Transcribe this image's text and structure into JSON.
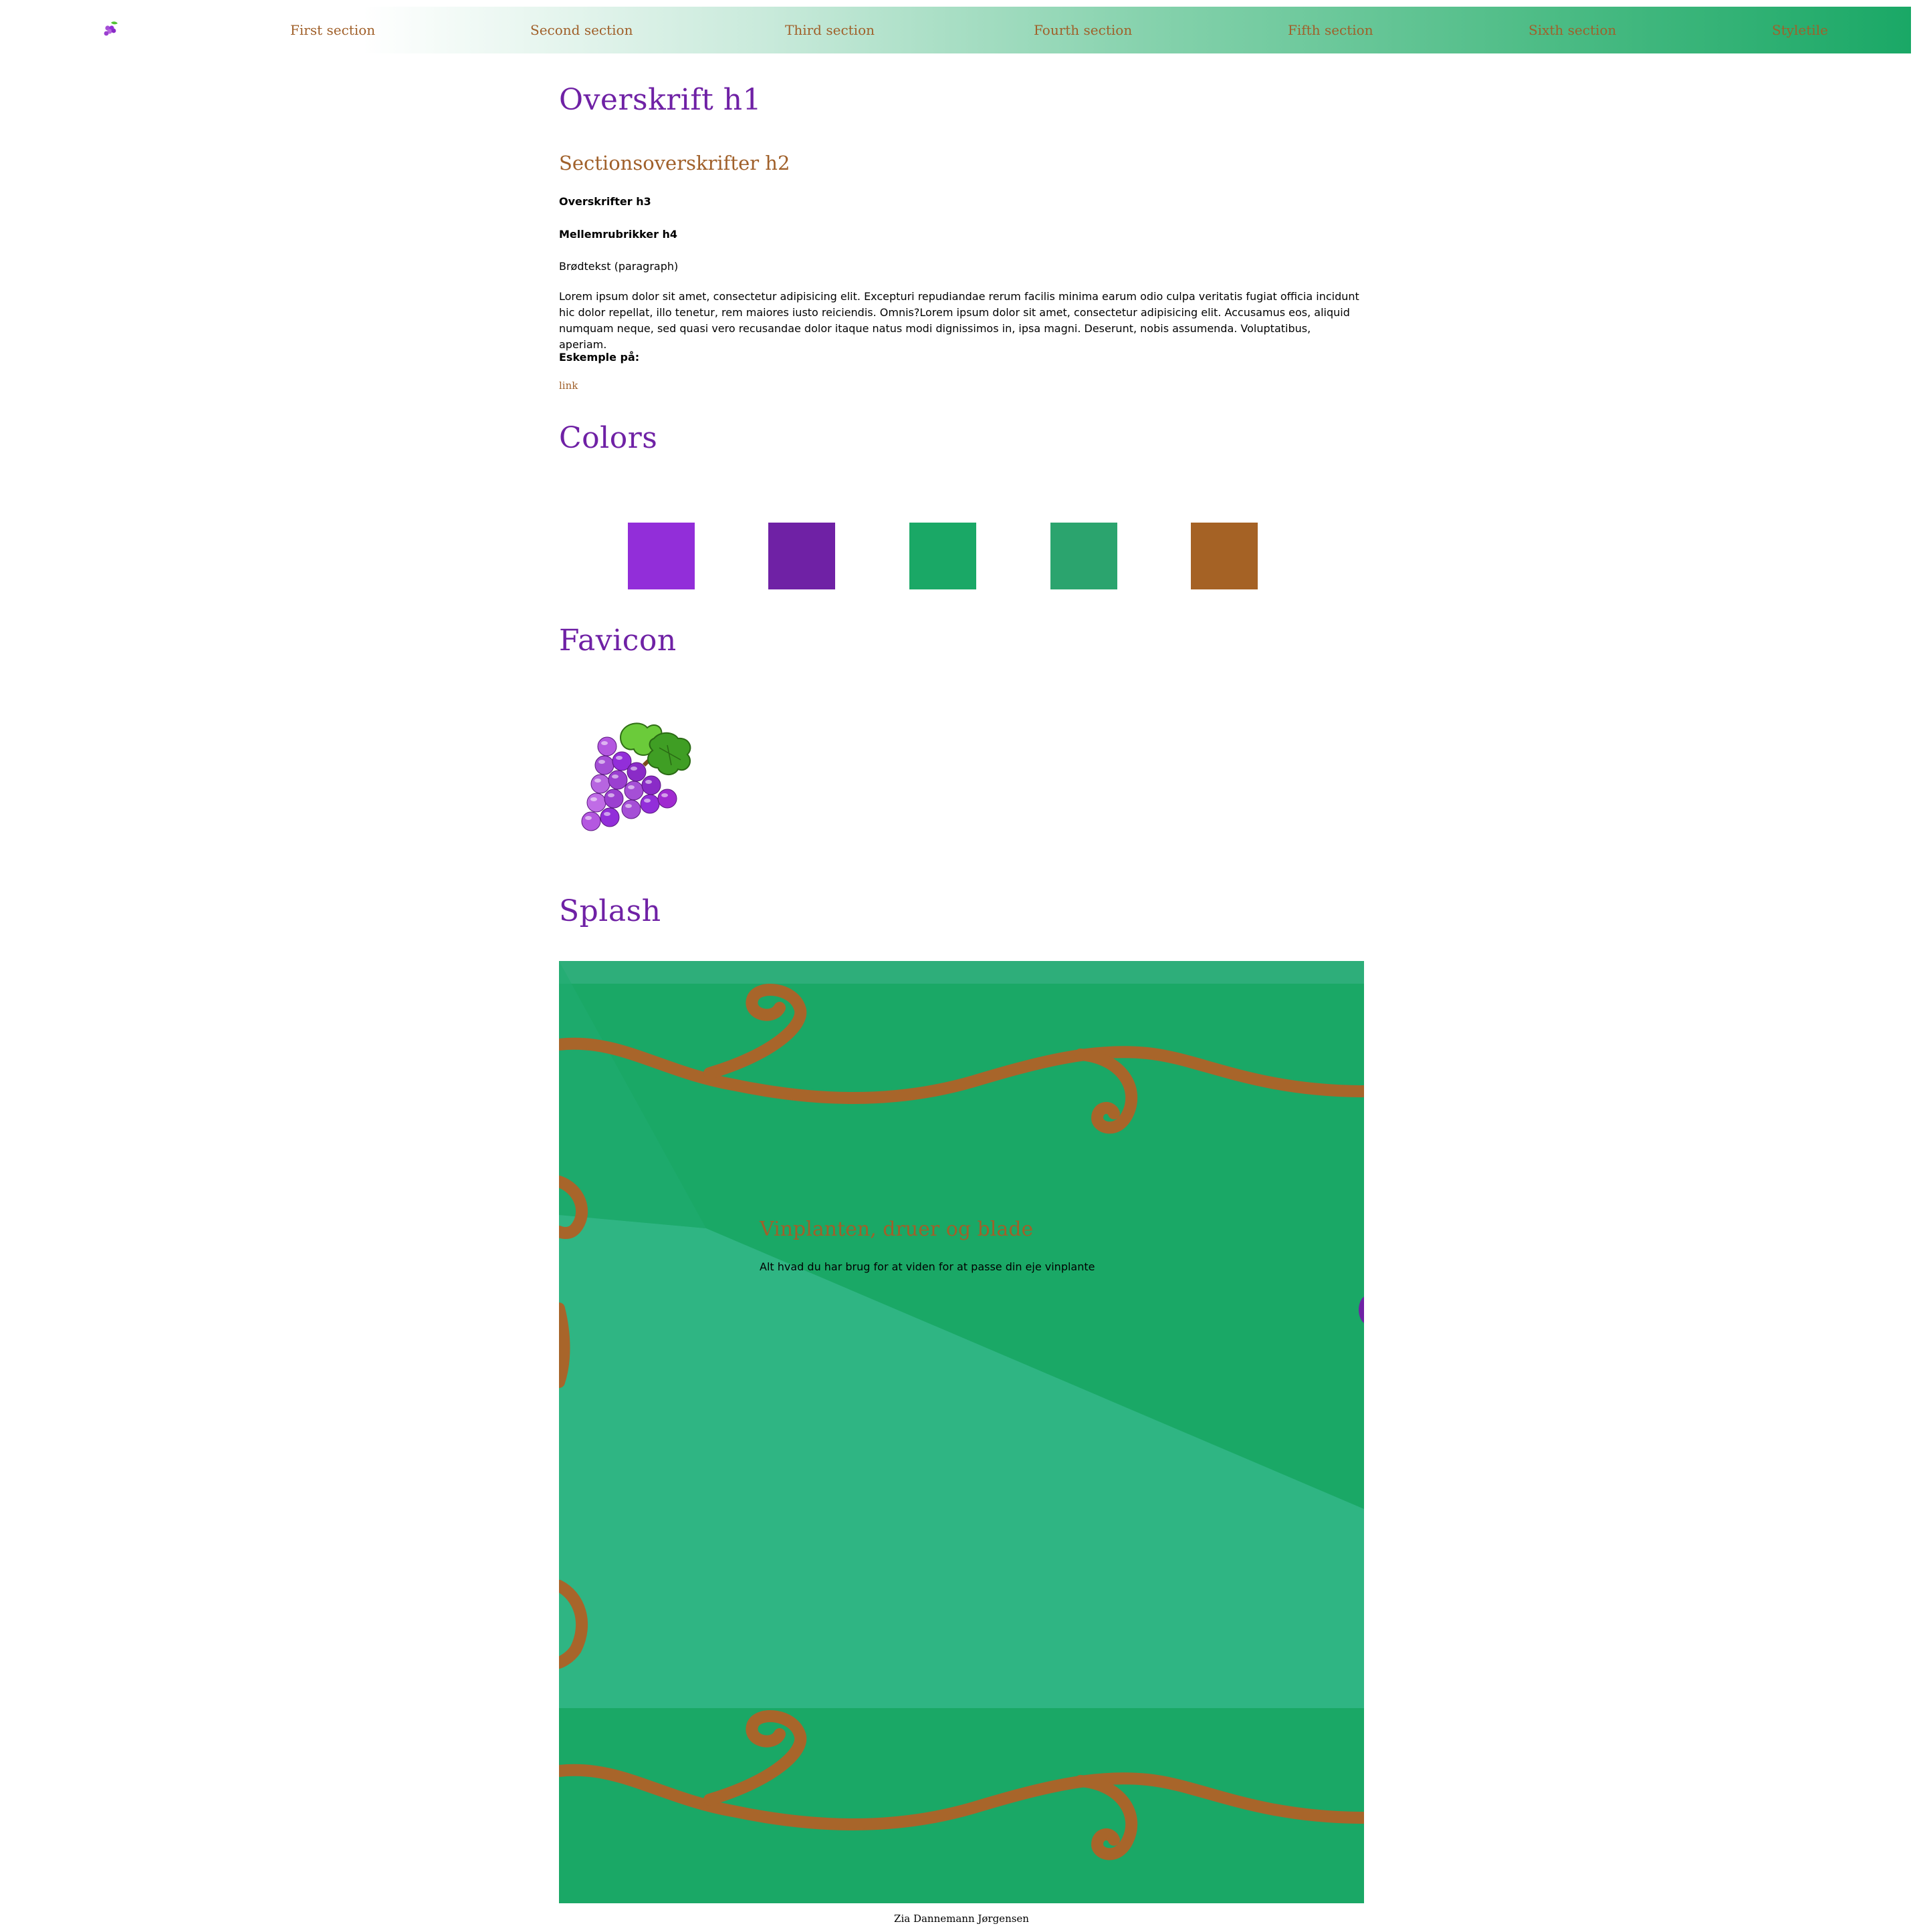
{
  "nav": {
    "logo": "grapes-icon",
    "items": [
      {
        "label": "First section"
      },
      {
        "label": "Second section"
      },
      {
        "label": "Third section"
      },
      {
        "label": "Fourth section"
      },
      {
        "label": "Fifth section"
      },
      {
        "label": "Sixth section"
      },
      {
        "label": "Styletile"
      }
    ]
  },
  "typography": {
    "h1": "Overskrift h1",
    "h2": "Sectionsoverskrifter h2",
    "h3": "Overskrifter h3",
    "h4": "Mellemrubrikker h4",
    "paragraph": "Brødtekst (paragraph)",
    "lorem": "Lorem ipsum dolor sit amet, consectetur adipisicing elit. Excepturi repudiandae rerum facilis minima earum odio culpa veritatis fugiat officia incidunt hic dolor repellat, illo tenetur, rem maiores iusto reiciendis. Omnis?Lorem ipsum dolor sit amet, consectetur adipisicing elit. Accusamus eos, aliquid numquam neque, sed quasi vero recusandae dolor itaque natus modi dignissimos in, ipsa magni. Deserunt, nobis assumenda. Voluptatibus, aperiam.",
    "example_label": "Eskemple på:",
    "link": "link"
  },
  "colors": {
    "heading": "Colors",
    "swatches": [
      "#922ed9",
      "#6f21a5",
      "#1aa866",
      "#2ba46e",
      "#a56225"
    ],
    "heading_color": "#6f21a5",
    "accent_color": "#a0602a"
  },
  "favicon": {
    "heading": "Favicon",
    "icon": "grapes-icon"
  },
  "splash": {
    "heading": "Splash",
    "title": "Vinplanten, druer og blade",
    "subtitle": "Alt hvad du har brug for at viden for at passe din eje vinplante"
  },
  "footer": {
    "text": "Zia Dannemann Jørgensen"
  }
}
